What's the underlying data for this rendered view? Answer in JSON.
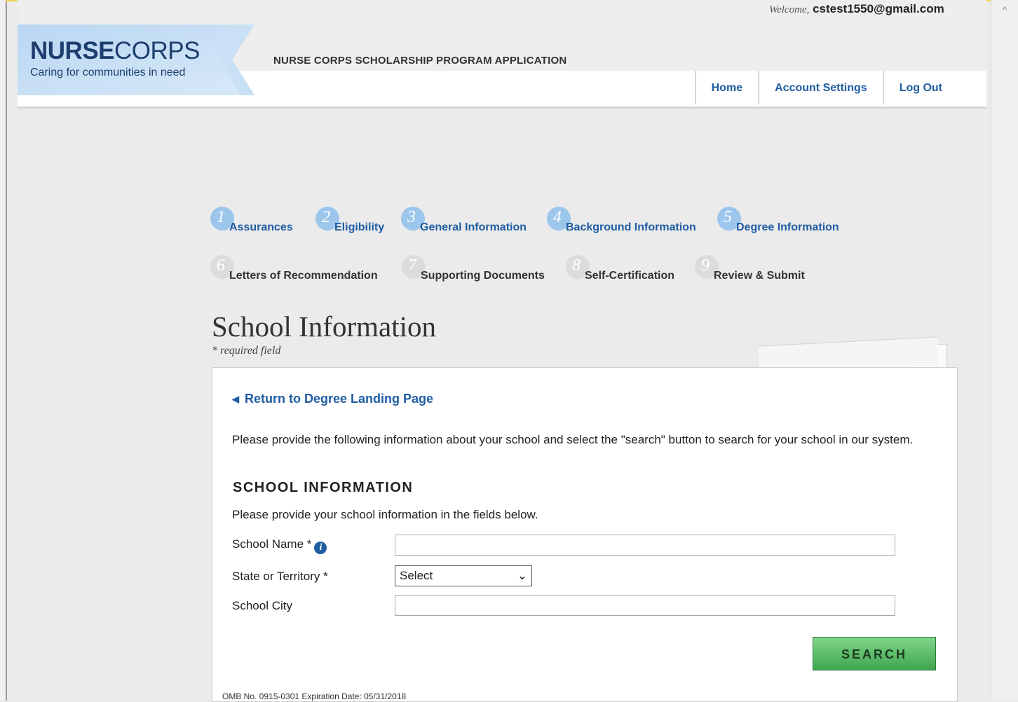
{
  "header": {
    "logo_nurse": "NURSE",
    "logo_corps": "CORPS",
    "logo_tagline": "Caring for communities in need",
    "app_title": "NURSE CORPS SCHOLARSHIP PROGRAM APPLICATION",
    "welcome_prefix": "Welcome,",
    "welcome_user": "cstest1550@gmail.com",
    "nav": [
      "Home",
      "Account Settings",
      "Log Out"
    ]
  },
  "steps": [
    {
      "num": "1",
      "label": "Assurances",
      "state": "active"
    },
    {
      "num": "2",
      "label": "Eligibility",
      "state": "active"
    },
    {
      "num": "3",
      "label": "General Information",
      "state": "active"
    },
    {
      "num": "4",
      "label": "Background Information",
      "state": "active"
    },
    {
      "num": "5",
      "label": "Degree Information",
      "state": "active"
    },
    {
      "num": "6",
      "label": "Letters of Recommendation",
      "state": "inactive"
    },
    {
      "num": "7",
      "label": "Supporting Documents",
      "state": "inactive"
    },
    {
      "num": "8",
      "label": "Self-Certification",
      "state": "inactive"
    },
    {
      "num": "9",
      "label": "Review & Submit",
      "state": "inactive"
    }
  ],
  "page": {
    "title": "School Information",
    "required_note": "* required field"
  },
  "form": {
    "back_link": "Return to Degree Landing Page",
    "intro": "Please provide the following information about your school and select the \"search\" button to search for your school in our system.",
    "section_heading": "SCHOOL INFORMATION",
    "section_sub": "Please provide your school information in the fields below.",
    "school_name_label": "School Name *",
    "school_name_value": "",
    "state_label": "State or Territory *",
    "state_selected": "Select",
    "city_label": "School City",
    "city_value": "",
    "search_label": "SEARCH"
  },
  "footer": {
    "omb": "OMB No. 0915-0301 Expiration Date: 05/31/2018"
  },
  "colors": {
    "link_blue": "#1f5da3",
    "step_active": "#9cc6ec",
    "step_inactive": "#dcdcdc",
    "search_green": "#3fa54e"
  }
}
